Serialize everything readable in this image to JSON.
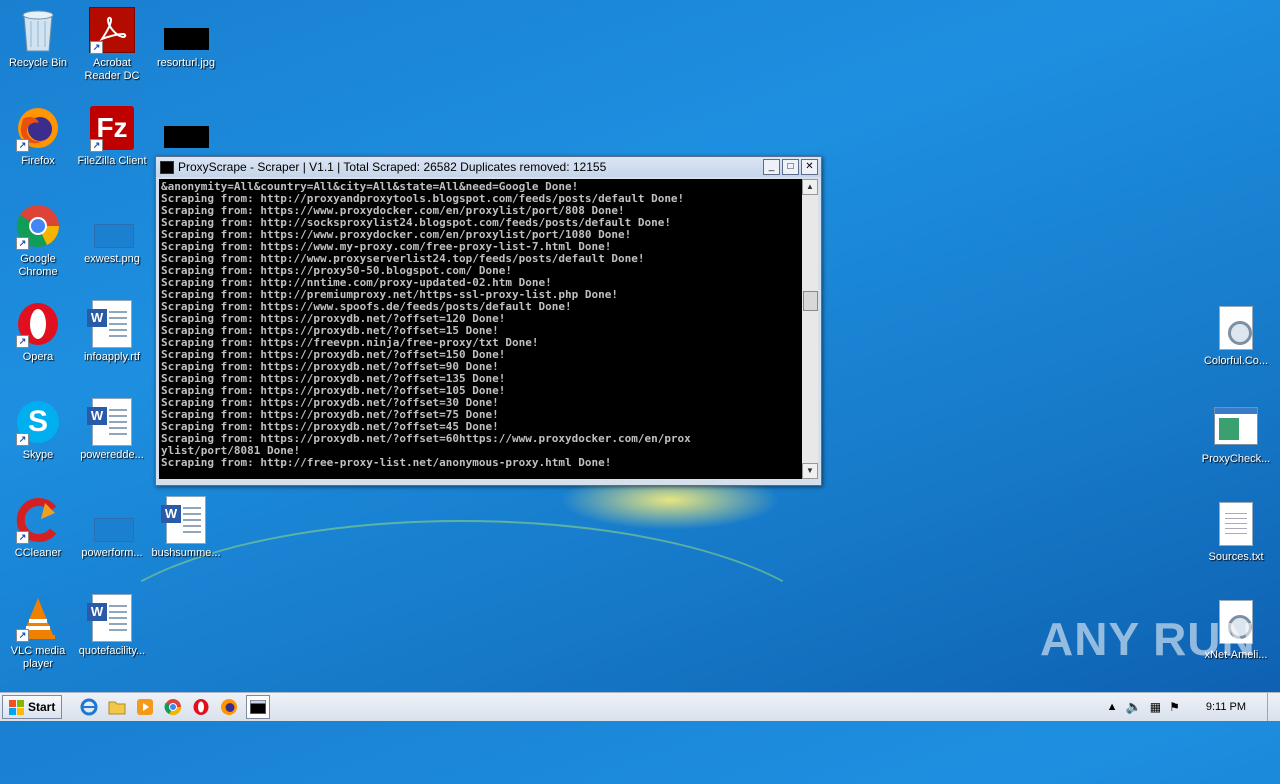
{
  "desktop": {
    "icons_left": [
      {
        "label": "Recycle Bin",
        "icon": "recycle-bin-icon"
      },
      {
        "label": "Acrobat\nReader DC",
        "icon": "acrobat-icon"
      },
      {
        "label": "resorturl.jpg",
        "icon": "image-file-icon"
      },
      {
        "label": "Firefox",
        "icon": "firefox-icon"
      },
      {
        "label": "FileZilla Client",
        "icon": "filezilla-icon"
      },
      {
        "label": "Google\nChrome",
        "icon": "chrome-icon"
      },
      {
        "label": "exwest.png",
        "icon": "image-file-icon"
      },
      {
        "label": "Opera",
        "icon": "opera-icon"
      },
      {
        "label": "infoapply.rtf",
        "icon": "word-doc-icon"
      },
      {
        "label": "Skype",
        "icon": "skype-icon"
      },
      {
        "label": "poweredde...",
        "icon": "word-doc-icon"
      },
      {
        "label": "CCleaner",
        "icon": "ccleaner-icon"
      },
      {
        "label": "powerform...",
        "icon": "image-file-icon"
      },
      {
        "label": "bushsumme...",
        "icon": "word-doc-icon"
      },
      {
        "label": "VLC media\nplayer",
        "icon": "vlc-icon"
      },
      {
        "label": "quotefacility...",
        "icon": "word-doc-icon"
      }
    ],
    "icons_right": [
      {
        "label": "Colorful.Co...",
        "icon": "settings-file-icon"
      },
      {
        "label": "ProxyCheck...",
        "icon": "app-window-icon"
      },
      {
        "label": "Sources.txt",
        "icon": "text-file-icon"
      },
      {
        "label": "xNet-Ameli...",
        "icon": "settings-file-icon"
      }
    ],
    "watermark": "ANY RUN"
  },
  "window": {
    "title": "ProxyScrape - Scraper | V1.1 | Total Scraped: 26582 Duplicates removed: 12155",
    "console_lines": [
      "&anonymity=All&country=All&city=All&state=All&need=Google Done!",
      "Scraping from: http://proxyandproxytools.blogspot.com/feeds/posts/default Done!",
      "Scraping from: https://www.proxydocker.com/en/proxylist/port/808 Done!",
      "Scraping from: http://socksproxylist24.blogspot.com/feeds/posts/default Done!",
      "Scraping from: https://www.proxydocker.com/en/proxylist/port/1080 Done!",
      "Scraping from: https://www.my-proxy.com/free-proxy-list-7.html Done!",
      "Scraping from: http://www.proxyserverlist24.top/feeds/posts/default Done!",
      "Scraping from: https://proxy50-50.blogspot.com/ Done!",
      "Scraping from: http://nntime.com/proxy-updated-02.htm Done!",
      "Scraping from: http://premiumproxy.net/https-ssl-proxy-list.php Done!",
      "Scraping from: https://www.spoofs.de/feeds/posts/default Done!",
      "Scraping from: https://proxydb.net/?offset=120 Done!",
      "Scraping from: https://proxydb.net/?offset=15 Done!",
      "Scraping from: https://freevpn.ninja/free-proxy/txt Done!",
      "Scraping from: https://proxydb.net/?offset=150 Done!",
      "Scraping from: https://proxydb.net/?offset=90 Done!",
      "Scraping from: https://proxydb.net/?offset=135 Done!",
      "Scraping from: https://proxydb.net/?offset=105 Done!",
      "Scraping from: https://proxydb.net/?offset=30 Done!",
      "Scraping from: https://proxydb.net/?offset=75 Done!",
      "Scraping from: https://proxydb.net/?offset=45 Done!",
      "Scraping from: https://proxydb.net/?offset=60https://www.proxydocker.com/en/prox",
      "ylist/port/8081 Done!",
      "Scraping from: http://free-proxy-list.net/anonymous-proxy.html Done!"
    ],
    "controls": {
      "minimize": "_",
      "maximize": "□",
      "close": "✕"
    }
  },
  "taskbar": {
    "start_label": "Start",
    "clock": "9:11 PM"
  }
}
